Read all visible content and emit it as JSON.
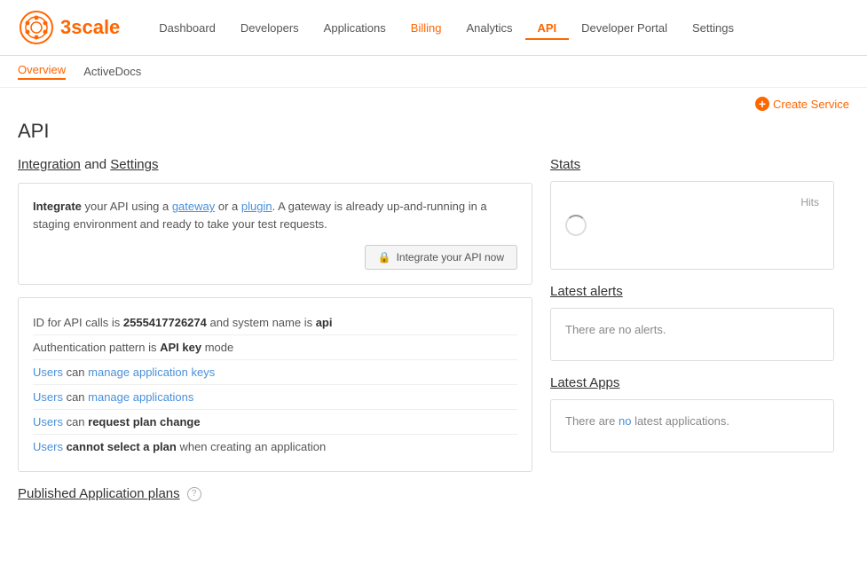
{
  "logo": {
    "text": "3scale"
  },
  "nav": {
    "items": [
      {
        "label": "Dashboard",
        "id": "dashboard",
        "active": false,
        "billing": false
      },
      {
        "label": "Developers",
        "id": "developers",
        "active": false,
        "billing": false
      },
      {
        "label": "Applications",
        "id": "applications",
        "active": false,
        "billing": false
      },
      {
        "label": "Billing",
        "id": "billing",
        "active": false,
        "billing": true
      },
      {
        "label": "Analytics",
        "id": "analytics",
        "active": false,
        "billing": false
      },
      {
        "label": "API",
        "id": "api",
        "active": true,
        "billing": false
      },
      {
        "label": "Developer Portal",
        "id": "developer-portal",
        "active": false,
        "billing": false
      },
      {
        "label": "Settings",
        "id": "settings",
        "active": false,
        "billing": false
      }
    ]
  },
  "subnav": {
    "items": [
      {
        "label": "Overview",
        "id": "overview",
        "active": true
      },
      {
        "label": "ActiveDocs",
        "id": "activedocs",
        "active": false
      }
    ]
  },
  "create_service": {
    "label": "Create Service"
  },
  "page": {
    "title": "API"
  },
  "integration_section": {
    "heading_link1": "Integration",
    "heading_text": " and ",
    "heading_link2": "Settings",
    "integrate_box": {
      "text_bold": "Integrate",
      "text1": " your API using a ",
      "gateway_link": "gateway",
      "text2": " or a ",
      "plugin_link": "plugin",
      "text3": ". A gateway is already up-and-running in a staging environment and ready to take your test requests.",
      "button_label": "Integrate your API now"
    },
    "info_rows": [
      {
        "id": "id-row",
        "text": "ID for API calls is ",
        "bold": "2555417726274",
        "text2": " and system name is ",
        "bold2": "api"
      },
      {
        "id": "auth-row",
        "text": "Authentication pattern is ",
        "bold": "API key",
        "text2": " mode"
      },
      {
        "id": "manage-keys-row",
        "link_text": "Users",
        "link_dest": "#",
        "text2": " can ",
        "link2": "manage application keys",
        "link2_dest": "#"
      },
      {
        "id": "manage-apps-row",
        "link_text": "Users",
        "link_dest": "#",
        "text2": " can ",
        "link2": "manage applications",
        "link2_dest": "#"
      },
      {
        "id": "request-plan-row",
        "link_text": "Users",
        "link_dest": "#",
        "text2": " can ",
        "bold": "request plan change"
      },
      {
        "id": "select-plan-row",
        "link_text": "Users",
        "link_dest": "#",
        "text2": " ",
        "bold": "cannot select a plan",
        "text3": " when creating an application"
      }
    ]
  },
  "stats_section": {
    "title": "Stats",
    "hits_label": "Hits",
    "loading": true
  },
  "alerts_section": {
    "title": "Latest alerts",
    "no_alerts_text": "There are no alerts."
  },
  "apps_section": {
    "title": "Latest Apps",
    "no_apps_text": "There are no latest applications."
  },
  "published_section": {
    "title": "Published Application plans"
  }
}
